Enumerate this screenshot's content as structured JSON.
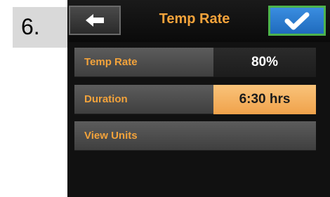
{
  "step": {
    "label": "6."
  },
  "header": {
    "title": "Temp Rate",
    "back_icon": "arrow-left-icon",
    "ok_icon": "checkmark-icon"
  },
  "rows": [
    {
      "label": "Temp Rate",
      "value": "80%"
    },
    {
      "label": "Duration",
      "value": "6:30 hrs"
    },
    {
      "label": "View Units"
    }
  ],
  "colors": {
    "accent_orange": "#f3a33b",
    "ok_button": "#2f7fd3",
    "ok_border": "#4db34d",
    "selected_value": "#f4b064"
  }
}
